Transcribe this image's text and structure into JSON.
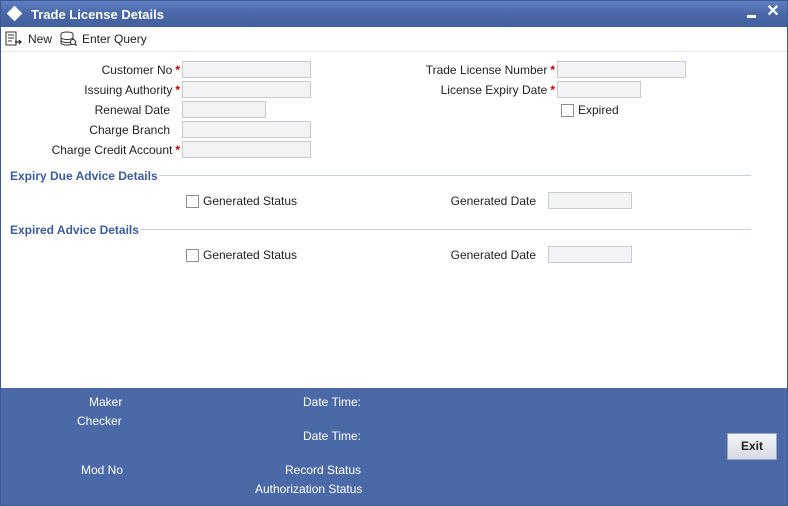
{
  "window": {
    "title": "Trade License Details",
    "minimize_glyph": "▬",
    "close_glyph": "✕"
  },
  "toolbar": {
    "new_label": "New",
    "enter_query_label": "Enter Query"
  },
  "form": {
    "customer_no": {
      "label": "Customer No",
      "required": "*",
      "value": ""
    },
    "issuing_authority": {
      "label": "Issuing Authority",
      "required": "*",
      "value": ""
    },
    "renewal_date": {
      "label": "Renewal Date",
      "value": ""
    },
    "charge_branch": {
      "label": "Charge Branch",
      "value": ""
    },
    "charge_credit_account": {
      "label": "Charge Credit Account",
      "required": "*",
      "value": ""
    },
    "trade_license_number": {
      "label": "Trade License Number",
      "required": "*",
      "value": ""
    },
    "license_expiry_date": {
      "label": "License Expiry Date",
      "required": "*",
      "value": ""
    },
    "expired": {
      "label": "Expired",
      "checked": false
    }
  },
  "expiry_due_advice": {
    "title": "Expiry Due Advice Details",
    "generated_status_label": "Generated Status",
    "generated_status_checked": false,
    "generated_date_label": "Generated Date",
    "generated_date_value": ""
  },
  "expired_advice": {
    "title": "Expired Advice Details",
    "generated_status_label": "Generated Status",
    "generated_status_checked": false,
    "generated_date_label": "Generated Date",
    "generated_date_value": ""
  },
  "footer": {
    "maker_label": "Maker",
    "checker_label": "Checker",
    "date_time_label_1": "Date Time:",
    "date_time_label_2": "Date Time:",
    "mod_no_label": "Mod No",
    "record_status_label": "Record Status",
    "authorization_status_label": "Authorization Status",
    "exit_label": "Exit"
  },
  "colors": {
    "titlebar": "#4a67a8",
    "footer": "#4b69a6",
    "section_title": "#3b5c9e",
    "required_mark": "#c00000"
  }
}
